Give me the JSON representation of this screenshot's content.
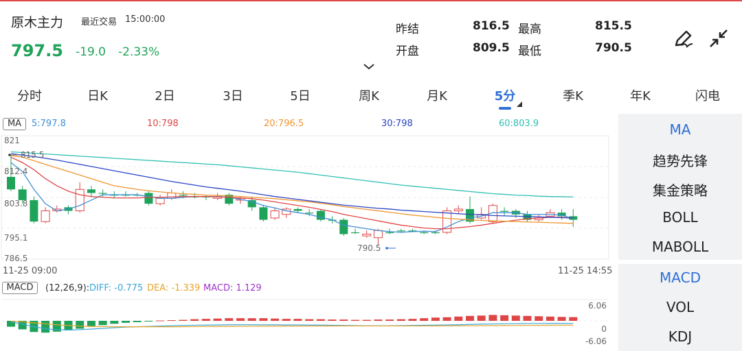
{
  "header": {
    "title": "原木主力",
    "trade_label": "最近交易",
    "trade_time": "15:00:00",
    "price": "797.5",
    "change": "-19.0",
    "change_pct": "-2.33%",
    "quote": [
      {
        "label": "昨结",
        "value": "816.5"
      },
      {
        "label": "最高",
        "value": "815.5"
      },
      {
        "label": "开盘",
        "value": "809.5"
      },
      {
        "label": "最低",
        "value": "790.5"
      }
    ]
  },
  "tabs": [
    "分时",
    "日K",
    "2日",
    "3日",
    "5日",
    "周K",
    "月K",
    "5分",
    "季K",
    "年K",
    "闪电"
  ],
  "active_tab": "5分",
  "ma_legend": {
    "chip": "MA",
    "items": [
      {
        "text": "5:797.8",
        "color": "#3d8fd6"
      },
      {
        "text": "10:798",
        "color": "#e04545"
      },
      {
        "text": "20:796.5",
        "color": "#f0952d"
      },
      {
        "text": "30:798",
        "color": "#2a44c4"
      },
      {
        "text": "60:803.9",
        "color": "#2fc0b4"
      }
    ]
  },
  "main_axis": {
    "labels": [
      "821",
      "812.4",
      "803.8",
      "795.1",
      "786.5"
    ],
    "high_marker": "815.5",
    "low_marker": "790.5"
  },
  "time_axis": {
    "start": "11-25 09:00",
    "end": "11-25 14:55"
  },
  "macd_legend": {
    "chip": "MACD",
    "params": "(12,26,9):",
    "items": [
      {
        "text": "DIFF: -0.775",
        "color": "#3aa6d8"
      },
      {
        "text": "DEA: -1.339",
        "color": "#e8a427"
      },
      {
        "text": "MACD: 1.129",
        "color": "#a035c8"
      }
    ]
  },
  "macd_axis": {
    "labels": [
      "6.06",
      "0",
      "-6.06"
    ]
  },
  "sidebar": {
    "group1": [
      "MA",
      "趋势先锋",
      "集金策略",
      "BOLL",
      "MABOLL"
    ],
    "group2": [
      "MACD",
      "VOL",
      "KDJ"
    ]
  },
  "colors": {
    "up": "#e04545",
    "down": "#1fa35a",
    "accent": "#2f6fd6"
  },
  "chart_data": {
    "type": "candlestick",
    "ylim": [
      786.5,
      821
    ],
    "candles": [
      {
        "o": 809.5,
        "c": 806,
        "h": 815.5,
        "l": 805.5
      },
      {
        "o": 806,
        "c": 803,
        "h": 807,
        "l": 802
      },
      {
        "o": 803,
        "c": 797,
        "h": 804,
        "l": 796.5
      },
      {
        "o": 797,
        "c": 800,
        "h": 801,
        "l": 796.5
      },
      {
        "o": 800,
        "c": 800.5,
        "h": 801.5,
        "l": 799.5
      },
      {
        "o": 801,
        "c": 800,
        "h": 801.5,
        "l": 799
      },
      {
        "o": 800,
        "c": 806,
        "h": 808,
        "l": 799.5
      },
      {
        "o": 806,
        "c": 805,
        "h": 807,
        "l": 804
      },
      {
        "o": 805,
        "c": 805,
        "h": 806,
        "l": 804
      },
      {
        "o": 804.5,
        "c": 804.5,
        "h": 805.5,
        "l": 803.5
      },
      {
        "o": 804.5,
        "c": 804.5,
        "h": 805.5,
        "l": 804
      },
      {
        "o": 804.5,
        "c": 804.5,
        "h": 805,
        "l": 804
      },
      {
        "o": 805,
        "c": 802,
        "h": 805.5,
        "l": 801.5
      },
      {
        "o": 802,
        "c": 803.5,
        "h": 804.5,
        "l": 801.5
      },
      {
        "o": 803.5,
        "c": 805,
        "h": 806,
        "l": 803
      },
      {
        "o": 804.5,
        "c": 804.5,
        "h": 805.5,
        "l": 803.5
      },
      {
        "o": 804,
        "c": 804,
        "h": 805,
        "l": 803.5
      },
      {
        "o": 804,
        "c": 804,
        "h": 804.5,
        "l": 803
      },
      {
        "o": 803.5,
        "c": 804,
        "h": 805,
        "l": 803
      },
      {
        "o": 804.5,
        "c": 802,
        "h": 805,
        "l": 801.5
      },
      {
        "o": 803,
        "c": 803.5,
        "h": 804,
        "l": 802
      },
      {
        "o": 803,
        "c": 801,
        "h": 804,
        "l": 800
      },
      {
        "o": 801,
        "c": 797.5,
        "h": 801.5,
        "l": 797
      },
      {
        "o": 798,
        "c": 800,
        "h": 801,
        "l": 797.5
      },
      {
        "o": 799,
        "c": 800.5,
        "h": 801,
        "l": 798
      },
      {
        "o": 800.5,
        "c": 800,
        "h": 801,
        "l": 799.5
      },
      {
        "o": 799.5,
        "c": 799.5,
        "h": 800.5,
        "l": 798.5
      },
      {
        "o": 800,
        "c": 797.5,
        "h": 800.5,
        "l": 797
      },
      {
        "o": 797.5,
        "c": 797.5,
        "h": 798.5,
        "l": 796.5
      },
      {
        "o": 797.5,
        "c": 793.5,
        "h": 798,
        "l": 793
      },
      {
        "o": 794,
        "c": 794,
        "h": 795,
        "l": 793.5
      },
      {
        "o": 793,
        "c": 793.5,
        "h": 794.5,
        "l": 792.5
      },
      {
        "o": 792.5,
        "c": 794.5,
        "h": 795,
        "l": 790.5
      },
      {
        "o": 794,
        "c": 794,
        "h": 795,
        "l": 793.5
      },
      {
        "o": 794.5,
        "c": 794.5,
        "h": 795,
        "l": 794
      },
      {
        "o": 794.5,
        "c": 794.5,
        "h": 795,
        "l": 794
      },
      {
        "o": 794,
        "c": 794,
        "h": 794.5,
        "l": 793.5
      },
      {
        "o": 794,
        "c": 794,
        "h": 794.5,
        "l": 793.5
      },
      {
        "o": 794,
        "c": 800,
        "h": 801,
        "l": 793.5
      },
      {
        "o": 800,
        "c": 800.5,
        "h": 801.5,
        "l": 799
      },
      {
        "o": 800.5,
        "c": 797,
        "h": 804,
        "l": 796.5
      },
      {
        "o": 798,
        "c": 799,
        "h": 801,
        "l": 797.5
      },
      {
        "o": 797,
        "c": 801.5,
        "h": 802,
        "l": 796.5
      },
      {
        "o": 800,
        "c": 800,
        "h": 801,
        "l": 798.5
      },
      {
        "o": 800,
        "c": 799,
        "h": 800.5,
        "l": 798
      },
      {
        "o": 799,
        "c": 797.5,
        "h": 800,
        "l": 797
      },
      {
        "o": 797.5,
        "c": 798,
        "h": 799,
        "l": 797
      },
      {
        "o": 798.5,
        "c": 799.5,
        "h": 800.5,
        "l": 798
      },
      {
        "o": 799.5,
        "c": 798.5,
        "h": 800.5,
        "l": 797.5
      },
      {
        "o": 798.5,
        "c": 797.5,
        "h": 800.5,
        "l": 795.5
      }
    ],
    "ma_series": [
      {
        "name": "5",
        "color": "#3d8fd6",
        "values": [
          813.5,
          811,
          806,
          802,
          800,
          800.5,
          801.5,
          803,
          804.5,
          804.5,
          804.5,
          804.5,
          804,
          803.5,
          803.5,
          803.8,
          804,
          804,
          804,
          803.8,
          803.2,
          802.6,
          801.5,
          800.8,
          800,
          799.5,
          799,
          798.2,
          797.5,
          796,
          795.5,
          795,
          794.5,
          794.2,
          794,
          794.2,
          794.3,
          794.2,
          795.5,
          797,
          798,
          798.5,
          799.5,
          799.5,
          799.5,
          799,
          799,
          799,
          798.8,
          797.8
        ]
      },
      {
        "name": "10",
        "color": "#e04545",
        "values": [
          815,
          813.5,
          811.5,
          809,
          807,
          805.5,
          804.5,
          804,
          803.8,
          803.6,
          803.6,
          803.6,
          803.8,
          803.8,
          803.9,
          804,
          804,
          804,
          803.9,
          803.8,
          803.6,
          803.4,
          803,
          802.5,
          802,
          801.5,
          801,
          800.4,
          799.8,
          799,
          798.4,
          797.8,
          797.2,
          796.6,
          796,
          795.6,
          795.2,
          795,
          795,
          795.3,
          795.6,
          796,
          796.5,
          797,
          797.4,
          797.8,
          798,
          798.2,
          798.2,
          798
        ]
      },
      {
        "name": "20",
        "color": "#f0952d",
        "values": [
          815.5,
          815,
          814,
          813,
          812,
          811,
          810,
          809,
          808,
          807,
          806.5,
          806,
          805.6,
          805.3,
          805,
          804.8,
          804.6,
          804.4,
          804.3,
          804.2,
          804,
          803.8,
          803.6,
          803.4,
          803.1,
          802.8,
          802.5,
          802.1,
          801.7,
          801.2,
          800.8,
          800.4,
          800,
          799.6,
          799.2,
          798.8,
          798.5,
          798.2,
          797.9,
          797.7,
          797.5,
          797.3,
          797.2,
          797.1,
          797,
          796.9,
          796.8,
          796.7,
          796.6,
          796.5
        ]
      },
      {
        "name": "30",
        "color": "#2a44c4",
        "values": [
          816,
          815.6,
          815.2,
          814.7,
          814.2,
          813.6,
          813,
          812.4,
          811.8,
          811.2,
          810.6,
          810,
          809.4,
          808.8,
          808.2,
          807.7,
          807.2,
          806.7,
          806.3,
          805.9,
          805.5,
          805,
          804.5,
          804,
          803.6,
          803.2,
          802.8,
          802.4,
          802,
          801.6,
          801.3,
          801,
          800.7,
          800.5,
          800.2,
          800,
          799.8,
          799.6,
          799.4,
          799.2,
          799,
          798.9,
          798.7,
          798.6,
          798.5,
          798.4,
          798.3,
          798.2,
          798.1,
          798
        ]
      },
      {
        "name": "60",
        "color": "#2fc0b4",
        "values": [
          816.5,
          816.3,
          816.1,
          815.9,
          815.7,
          815.5,
          815.3,
          815.1,
          814.9,
          814.7,
          814.5,
          814.3,
          814.1,
          813.9,
          813.7,
          813.5,
          813.3,
          813.1,
          812.9,
          812.6,
          812.3,
          812,
          811.7,
          811.4,
          811.1,
          810.8,
          810.4,
          810,
          809.6,
          809.2,
          808.8,
          808.4,
          808,
          807.6,
          807.2,
          806.9,
          806.6,
          806.3,
          806,
          805.7,
          805.4,
          805.1,
          804.8,
          804.6,
          804.4,
          804.3,
          804.1,
          804,
          803.95,
          803.9
        ]
      }
    ],
    "macd": {
      "ylim": [
        -6.06,
        6.06
      ],
      "hist": [
        -1.8,
        -2.6,
        -3.4,
        -3.6,
        -3.3,
        -2.9,
        -2.4,
        -1.8,
        -1.3,
        -0.9,
        -0.6,
        -0.4,
        -0.2,
        0.1,
        0.2,
        0.3,
        0.5,
        0.6,
        0.7,
        0.8,
        0.8,
        0.8,
        0.8,
        0.7,
        0.6,
        0.6,
        0.5,
        0.5,
        0.4,
        0.4,
        0.3,
        0.3,
        0.4,
        0.4,
        0.5,
        0.6,
        0.8,
        1.0,
        1.1,
        1.3,
        1.5,
        1.6,
        1.8,
        1.7,
        1.6,
        1.5,
        1.4,
        1.3,
        1.2,
        1.129
      ],
      "diff": [
        -0.3,
        -1.0,
        -1.8,
        -2.4,
        -2.7,
        -2.8,
        -2.7,
        -2.5,
        -2.3,
        -2.1,
        -1.9,
        -1.8,
        -1.7,
        -1.6,
        -1.5,
        -1.4,
        -1.35,
        -1.3,
        -1.25,
        -1.2,
        -1.2,
        -1.2,
        -1.2,
        -1.2,
        -1.25,
        -1.25,
        -1.3,
        -1.3,
        -1.35,
        -1.4,
        -1.45,
        -1.5,
        -1.5,
        -1.5,
        -1.45,
        -1.4,
        -1.35,
        -1.3,
        -1.25,
        -1.2,
        -1.1,
        -1.0,
        -0.95,
        -0.9,
        -0.85,
        -0.82,
        -0.8,
        -0.79,
        -0.78,
        -0.775
      ],
      "dea": [
        -0.1,
        -0.3,
        -0.6,
        -0.9,
        -1.2,
        -1.4,
        -1.6,
        -1.7,
        -1.75,
        -1.8,
        -1.8,
        -1.8,
        -1.8,
        -1.8,
        -1.8,
        -1.78,
        -1.76,
        -1.74,
        -1.72,
        -1.7,
        -1.68,
        -1.66,
        -1.64,
        -1.62,
        -1.6,
        -1.6,
        -1.58,
        -1.57,
        -1.56,
        -1.55,
        -1.55,
        -1.55,
        -1.55,
        -1.55,
        -1.55,
        -1.55,
        -1.55,
        -1.54,
        -1.53,
        -1.52,
        -1.5,
        -1.48,
        -1.46,
        -1.44,
        -1.42,
        -1.4,
        -1.38,
        -1.36,
        -1.35,
        -1.339
      ]
    }
  }
}
